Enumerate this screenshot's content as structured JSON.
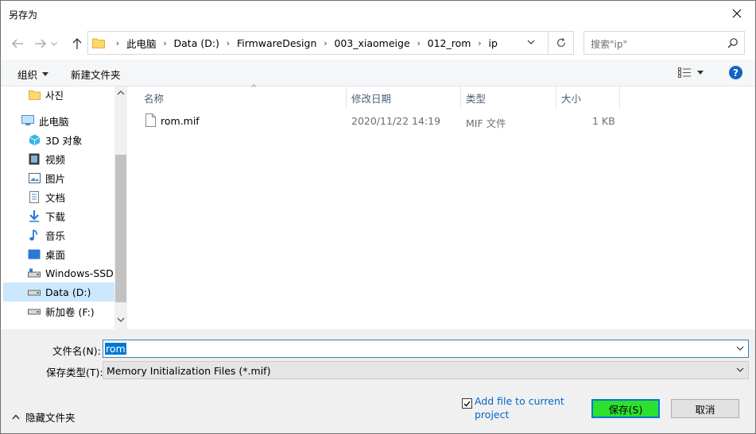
{
  "window": {
    "title": "另存为"
  },
  "address": {
    "crumbs": [
      "此电脑",
      "Data (D:)",
      "FirmwareDesign",
      "003_xiaomeige",
      "012_rom",
      "ip"
    ]
  },
  "search": {
    "placeholder": "搜索\"ip\""
  },
  "toolbar": {
    "organize": "组织",
    "new_folder": "新建文件夹"
  },
  "nav": {
    "items": [
      {
        "label": "사진",
        "icon": "folder-icon"
      },
      {
        "label": "此电脑",
        "icon": "computer-icon"
      },
      {
        "label": "3D 对象",
        "icon": "3d-objects-icon"
      },
      {
        "label": "视频",
        "icon": "video-icon"
      },
      {
        "label": "图片",
        "icon": "pictures-icon"
      },
      {
        "label": "文档",
        "icon": "documents-icon"
      },
      {
        "label": "下载",
        "icon": "download-icon"
      },
      {
        "label": "音乐",
        "icon": "music-icon"
      },
      {
        "label": "桌面",
        "icon": "desktop-icon"
      },
      {
        "label": "Windows-SSD",
        "icon": "drive-icon"
      },
      {
        "label": "Data (D:)",
        "icon": "drive-icon"
      },
      {
        "label": "新加卷 (F:)",
        "icon": "drive-icon"
      }
    ]
  },
  "columns": {
    "name": "名称",
    "modified": "修改日期",
    "type": "类型",
    "size": "大小"
  },
  "files": [
    {
      "name": "rom.mif",
      "modified": "2020/11/22 14:19",
      "type": "MIF 文件",
      "size": "1 KB"
    }
  ],
  "form": {
    "filename_label": "文件名(N):",
    "filename_value": "rom",
    "filetype_label": "保存类型(T):",
    "filetype_value": "Memory Initialization Files (*.mif)"
  },
  "options": {
    "add_file_label": "Add file to current project",
    "add_file_checked": true
  },
  "buttons": {
    "save": "保存(S)",
    "cancel": "取消",
    "hide_folders": "隐藏文件夹"
  },
  "colors": {
    "accent": "#0078d7",
    "save_button": "#2ee02e",
    "link": "#0066cc",
    "selected": "#cce8ff"
  }
}
